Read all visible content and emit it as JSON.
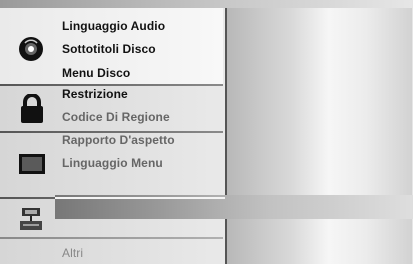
{
  "menu": {
    "groups": [
      {
        "icon": "disc-icon",
        "items": [
          "Linguaggio Audio",
          "Sottotitoli Disco",
          "Menu Disco"
        ]
      },
      {
        "icon": "padlock-icon",
        "items": [
          "Restrizione",
          "Codice Di Regione"
        ]
      },
      {
        "icon": "display-icon",
        "items": [
          "Rapporto D'aspetto",
          "Linguaggio Menu"
        ]
      },
      {
        "icon": "network-icon",
        "items": []
      }
    ],
    "other_label": "Altri"
  }
}
